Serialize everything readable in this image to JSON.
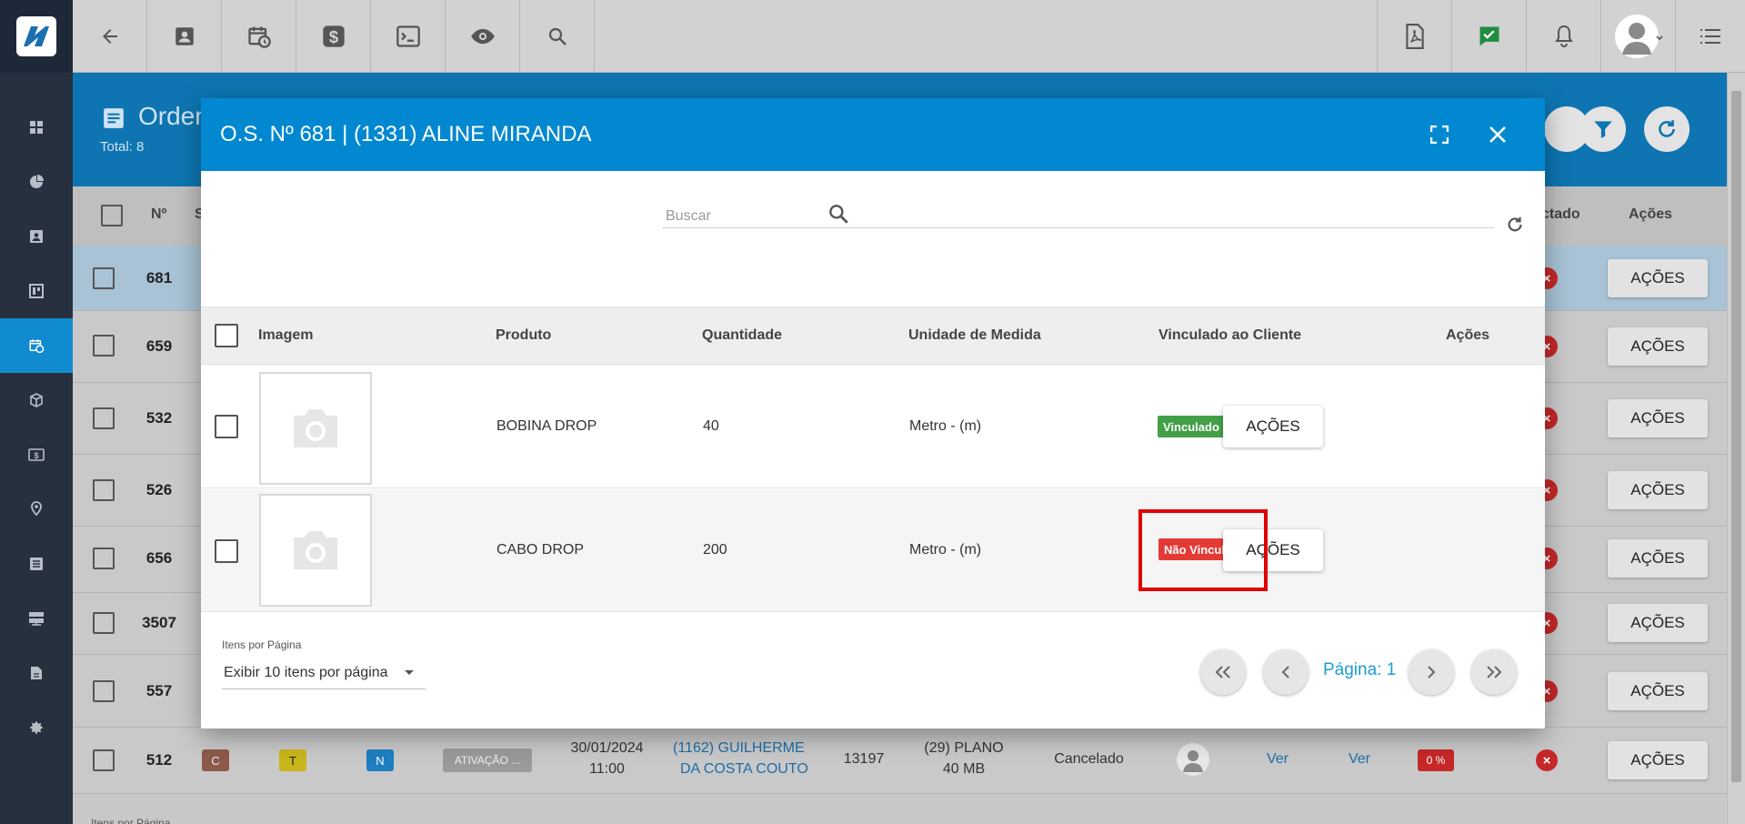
{
  "topbar": {
    "left_icons": [
      "back-arrow-icon",
      "contact-card-icon",
      "calendar-clock-icon",
      "dollar-icon",
      "terminal-icon",
      "eye-icon",
      "search-icon"
    ],
    "right_icons": [
      "pdf-icon",
      "chat-check-icon",
      "bell-icon",
      "avatar",
      "menu-icon"
    ]
  },
  "sidebar": {
    "icons": [
      "dashboard-icon",
      "pie-chart-icon",
      "contact-icon",
      "board-icon",
      "calendar-clock-icon",
      "box-icon",
      "money-icon",
      "location-icon",
      "list-icon",
      "server-icon",
      "document-icon",
      "settings-icon"
    ]
  },
  "background": {
    "page_title": "Orden",
    "total": "Total: 8",
    "col_num": "Nº",
    "col_s": "S",
    "col_contato": "ctado",
    "col_acoes": "Ações",
    "rows": [
      {
        "num": "681"
      },
      {
        "num": "659"
      },
      {
        "num": "532"
      },
      {
        "num": "526"
      },
      {
        "num": "656"
      },
      {
        "num": "3507"
      },
      {
        "num": "557"
      },
      {
        "num": "512",
        "badge_c": "C",
        "badge_t": "T",
        "badge_n": "N",
        "tipo": "ATIVAÇÃO ...",
        "data": "30/01/2024",
        "hora": "11:00",
        "cliente_l1": "(1162) GUILHERME",
        "cliente_l2": "DA COSTA COUTO",
        "codigo": "13197",
        "plano_l1": "(29) PLANO",
        "plano_l2": "40 MB",
        "status": "Cancelado",
        "ver1": "Ver",
        "ver2": "Ver",
        "percent": "0 %"
      }
    ],
    "acoes_label": "AÇÕES",
    "footer_partial": "Itens por Página"
  },
  "modal": {
    "title": "O.S. Nº 681 | (1331) ALINE MIRANDA",
    "search_placeholder": "Buscar",
    "columns": {
      "imagem": "Imagem",
      "produto": "Produto",
      "quantidade": "Quantidade",
      "unidade": "Unidade de Medida",
      "vinculado": "Vinculado ao Cliente",
      "acoes": "Ações"
    },
    "rows": [
      {
        "produto": "BOBINA DROP",
        "quantidade": "40",
        "unidade": "Metro - (m)",
        "vinculado": "Vinculado",
        "vinculado_color": "#43a047",
        "acoes": "AÇÕES"
      },
      {
        "produto": "CABO DROP",
        "quantidade": "200",
        "unidade": "Metro - (m)",
        "vinculado": "Não Vinculado",
        "vinculado_color": "#e53935",
        "acoes": "AÇÕES"
      }
    ],
    "pagination": {
      "items_label": "Itens por Página",
      "items_value": "Exibir 10 itens por página",
      "page_label": "Página: 1"
    }
  }
}
